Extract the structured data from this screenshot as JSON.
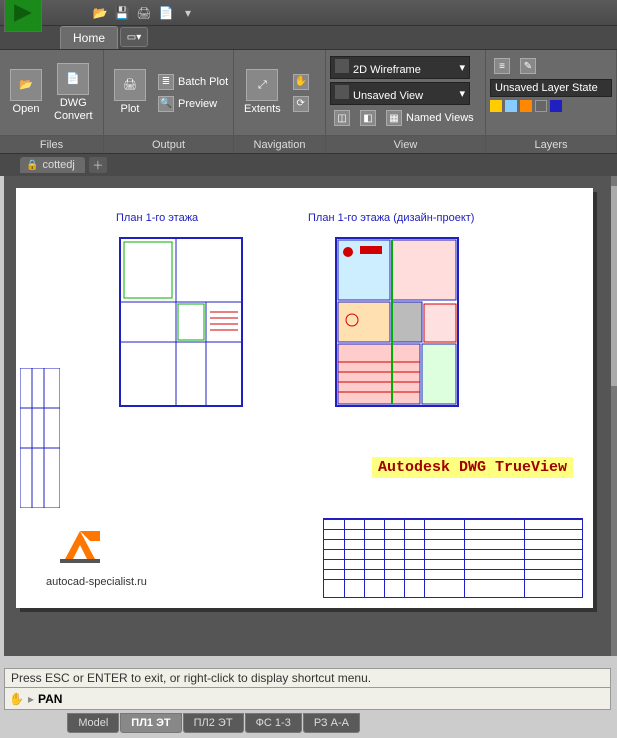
{
  "qat": {
    "icons": [
      "open",
      "save",
      "print",
      "export",
      "undo"
    ]
  },
  "tabs": {
    "home": "Home"
  },
  "ribbon": {
    "files": {
      "title": "Files",
      "open": "Open",
      "dwgconvert": "DWG\nConvert"
    },
    "output": {
      "title": "Output",
      "plot": "Plot",
      "batchplot": "Batch Plot",
      "preview": "Preview"
    },
    "navigation": {
      "title": "Navigation",
      "extents": "Extents"
    },
    "view": {
      "title": "View",
      "wireframe": "2D Wireframe",
      "unsaved": "Unsaved View",
      "named": "Named Views"
    },
    "layers": {
      "title": "Layers",
      "state": "Unsaved Layer State"
    }
  },
  "file": {
    "name": "cottedj"
  },
  "drawing": {
    "title1": "План 1-го этажа",
    "title2": "План 1-го этажа (дизайн-проект)",
    "watermark": "Autodesk DWG TrueView",
    "site": "autocad-specialist.ru"
  },
  "cmd": {
    "hint": "Press ESC or ENTER to exit, or right-click to display shortcut menu.",
    "mode": "PAN"
  },
  "layouts": {
    "model": "Model",
    "l1": "ПЛ1 ЭТ",
    "l2": "ПЛ2 ЭТ",
    "l3": "ФС 1-3",
    "l4": "РЗ А-А"
  }
}
